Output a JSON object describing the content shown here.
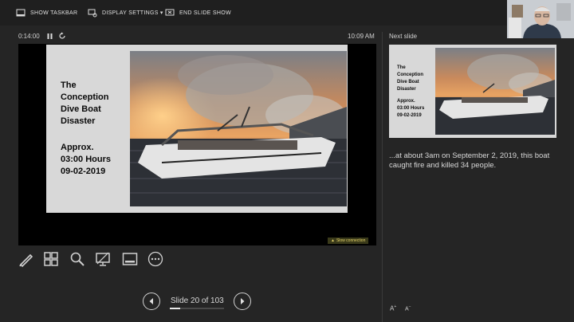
{
  "toolbar": {
    "show_taskbar": "SHOW TASKBAR",
    "display_settings": "DISPLAY SETTINGS ▾",
    "end_slide_show": "END SLIDE SHOW"
  },
  "presenter": {
    "elapsed_time": "0:14:00",
    "clock": "10:09 AM"
  },
  "current_slide": {
    "title_lines": [
      "The",
      "Conception",
      "Dive Boat",
      "Disaster"
    ],
    "time_lines": [
      "Approx.",
      "03:00 Hours",
      "09-02-2019"
    ],
    "photo": "burning-boat-photo",
    "slow_connection": "Slow connection"
  },
  "tools": [
    "pen-tool-icon",
    "see-all-slides-icon",
    "zoom-icon",
    "black-screen-icon",
    "subtitles-icon",
    "more-options-icon"
  ],
  "navigation": {
    "counter": "Slide 20 of 103",
    "progress": 0.19
  },
  "next_slide": {
    "label": "Next slide",
    "title_lines": [
      "The",
      "Conception",
      "Dive Boat",
      "Disaster"
    ],
    "time_lines": [
      "Approx.",
      "03:00 Hours",
      "09-02-2019"
    ]
  },
  "notes": {
    "text": "...at about 3am on September 2, 2019, this boat caught fire and killed 34 people."
  },
  "font_controls": {
    "increase": "A",
    "decrease": "A"
  }
}
